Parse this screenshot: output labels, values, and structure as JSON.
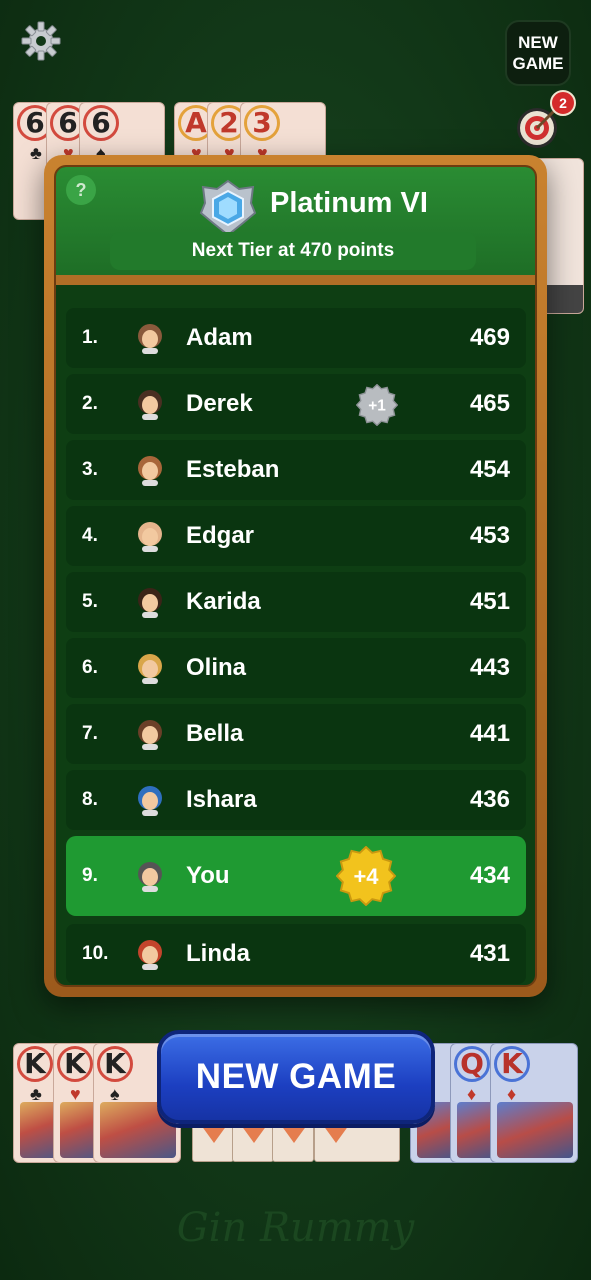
{
  "top_bar": {
    "settings_icon": "gear-icon",
    "new_game_label_line1": "NEW",
    "new_game_label_line2": "GAME",
    "target_icon": "dartboard-icon",
    "target_badge": "2"
  },
  "top_cards": {
    "left_meld": [
      "6",
      "6",
      "6"
    ],
    "right_meld": [
      "A",
      "2",
      "3"
    ]
  },
  "leaderboard": {
    "help_label": "?",
    "tier_icon": "platinum-shield-icon",
    "tier_name": "Platinum VI",
    "next_tier_text": "Next Tier at 470 points",
    "rows": [
      {
        "pos": "1.",
        "name": "Adam",
        "score": "469",
        "badge": ""
      },
      {
        "pos": "2.",
        "name": "Derek",
        "score": "465",
        "badge": "+1"
      },
      {
        "pos": "3.",
        "name": "Esteban",
        "score": "454",
        "badge": ""
      },
      {
        "pos": "4.",
        "name": "Edgar",
        "score": "453",
        "badge": ""
      },
      {
        "pos": "5.",
        "name": "Karida",
        "score": "451",
        "badge": ""
      },
      {
        "pos": "6.",
        "name": "Olina",
        "score": "443",
        "badge": ""
      },
      {
        "pos": "7.",
        "name": "Bella",
        "score": "441",
        "badge": ""
      },
      {
        "pos": "8.",
        "name": "Ishara",
        "score": "436",
        "badge": ""
      },
      {
        "pos": "9.",
        "name": "You",
        "score": "434",
        "badge": "+4"
      },
      {
        "pos": "10.",
        "name": "Linda",
        "score": "431",
        "badge": ""
      }
    ]
  },
  "bottom_cards": {
    "left_meld": [
      "K",
      "K",
      "K"
    ],
    "right_meld": [
      "Q",
      "K"
    ]
  },
  "bottom_button": {
    "label": "NEW GAME"
  },
  "watermark": "Gin Rummy",
  "colors": {
    "felt": "#123818",
    "panel_wood": "#b06e26",
    "header_green": "#2a8c33",
    "row_dark": "#0a3510",
    "row_highlight": "#1f9a32",
    "button_blue": "#1c3fc1"
  }
}
